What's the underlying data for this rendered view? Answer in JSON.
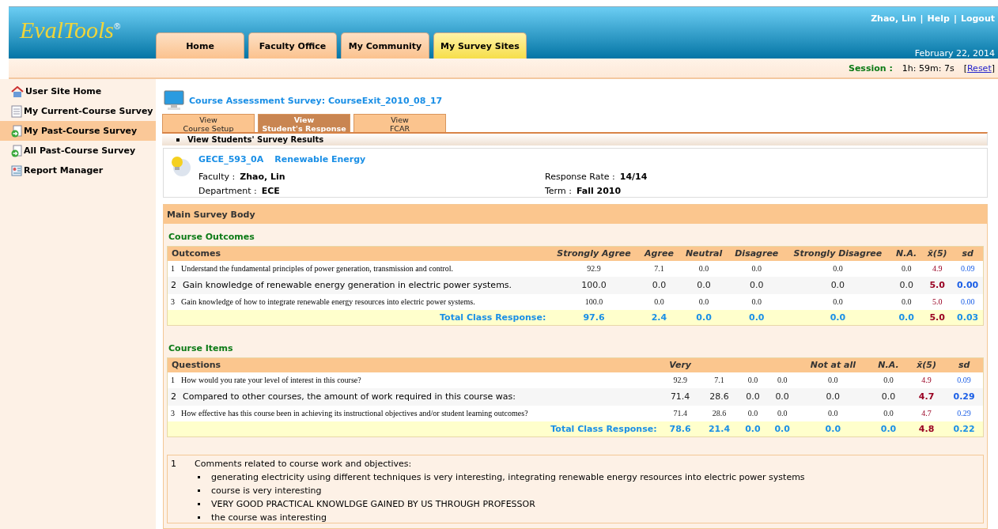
{
  "header": {
    "logo": "EvalTools",
    "logo_mark": "®",
    "user_links": [
      "Zhao, Lin",
      "Help",
      "Logout"
    ],
    "link_separator": "|",
    "date": "February 22, 2014",
    "tabs": [
      {
        "label": "Home",
        "selected": false
      },
      {
        "label": "Faculty Office",
        "selected": false
      },
      {
        "label": "My Community",
        "selected": false
      },
      {
        "label": "My Survey Sites",
        "selected": true
      }
    ]
  },
  "session": {
    "label": "Session :",
    "time": "1h: 59m: 7s",
    "reset_open": "[",
    "reset": "Reset",
    "reset_close": "]"
  },
  "sidebar": {
    "items": [
      {
        "label": "User Site Home",
        "kind": "home",
        "selected": false
      },
      {
        "label": "My Current-Course Survey",
        "kind": "document",
        "selected": false
      },
      {
        "label": "My Past-Course Survey",
        "kind": "archive",
        "selected": true
      },
      {
        "label": "All Past-Course Survey",
        "kind": "archive",
        "selected": false
      },
      {
        "label": "Report Manager",
        "kind": "report",
        "selected": false
      }
    ]
  },
  "survey_title": "Course Assessment Survey: CourseExit_2010_08_17",
  "view_tabs": [
    {
      "line1": "View",
      "line2": "Course Setup",
      "selected": false
    },
    {
      "line1": "View",
      "line2": "Student's Response",
      "selected": true
    },
    {
      "line1": "View",
      "line2": "FCAR",
      "selected": false
    }
  ],
  "subheading": "View Students' Survey Results",
  "course": {
    "code": "GECE_593_0A",
    "name": "Renewable Energy",
    "faculty_label": "Faculty :",
    "faculty": "Zhao, Lin",
    "department_label": "Department :",
    "department": "ECE",
    "response_label": "Response Rate :",
    "response": "14/14",
    "term_label": "Term :",
    "term": "Fall 2010"
  },
  "main_title": "Main Survey Body",
  "outcomes": {
    "title": "Course Outcomes",
    "columns": [
      "Outcomes",
      "Strongly Agree",
      "Agree",
      "Neutral",
      "Disagree",
      "Strongly Disagree",
      "N.A.",
      "x̄(5)",
      "sd"
    ],
    "rows": [
      {
        "num": "1",
        "text": "Understand the fundamental principles of power generation, transmission and control.",
        "values": [
          "92.9",
          "7.1",
          "0.0",
          "0.0",
          "0.0",
          "0.0",
          "4.9",
          "0.09"
        ]
      },
      {
        "num": "2",
        "text": "Gain knowledge of renewable energy generation in electric power systems.",
        "values": [
          "100.0",
          "0.0",
          "0.0",
          "0.0",
          "0.0",
          "0.0",
          "5.0",
          "0.00"
        ]
      },
      {
        "num": "3",
        "text": "Gain knowledge of how to integrate renewable energy resources into electric power systems.",
        "values": [
          "100.0",
          "0.0",
          "0.0",
          "0.0",
          "0.0",
          "0.0",
          "5.0",
          "0.00"
        ]
      }
    ],
    "total_label": "Total Class Response:",
    "totals": [
      "97.6",
      "2.4",
      "0.0",
      "0.0",
      "0.0",
      "0.0",
      "5.0",
      "0.03"
    ]
  },
  "items": {
    "title": "Course Items",
    "columns": [
      "Questions",
      "Very",
      "",
      "",
      "",
      "Not at all",
      "N.A.",
      "x̄(5)",
      "sd"
    ],
    "rows": [
      {
        "num": "1",
        "text": "How would you rate your level of interest in this course?",
        "values": [
          "92.9",
          "7.1",
          "0.0",
          "0.0",
          "0.0",
          "0.0",
          "4.9",
          "0.09"
        ]
      },
      {
        "num": "2",
        "text": "Compared to other courses, the amount of work required in this course was:",
        "values": [
          "71.4",
          "28.6",
          "0.0",
          "0.0",
          "0.0",
          "0.0",
          "4.7",
          "0.29"
        ]
      },
      {
        "num": "3",
        "text": "How effective has this course been in achieving its instructional objectives and/or student learning outcomes?",
        "values": [
          "71.4",
          "28.6",
          "0.0",
          "0.0",
          "0.0",
          "0.0",
          "4.7",
          "0.29"
        ]
      }
    ],
    "total_label": "Total Class Response:",
    "totals": [
      "78.6",
      "21.4",
      "0.0",
      "0.0",
      "0.0",
      "0.0",
      "4.8",
      "0.22"
    ]
  },
  "comments": {
    "num": "1",
    "title": "Comments related to course work and objectives:",
    "entries": [
      "generating electricity using different techniques is very interesting, integrating renewable energy resources into electric power systems",
      "course is very interesting",
      "VERY GOOD PRACTICAL KNOWLDGE GAINED BY US THROUGH PROFESSOR",
      "the course was interesting"
    ]
  }
}
